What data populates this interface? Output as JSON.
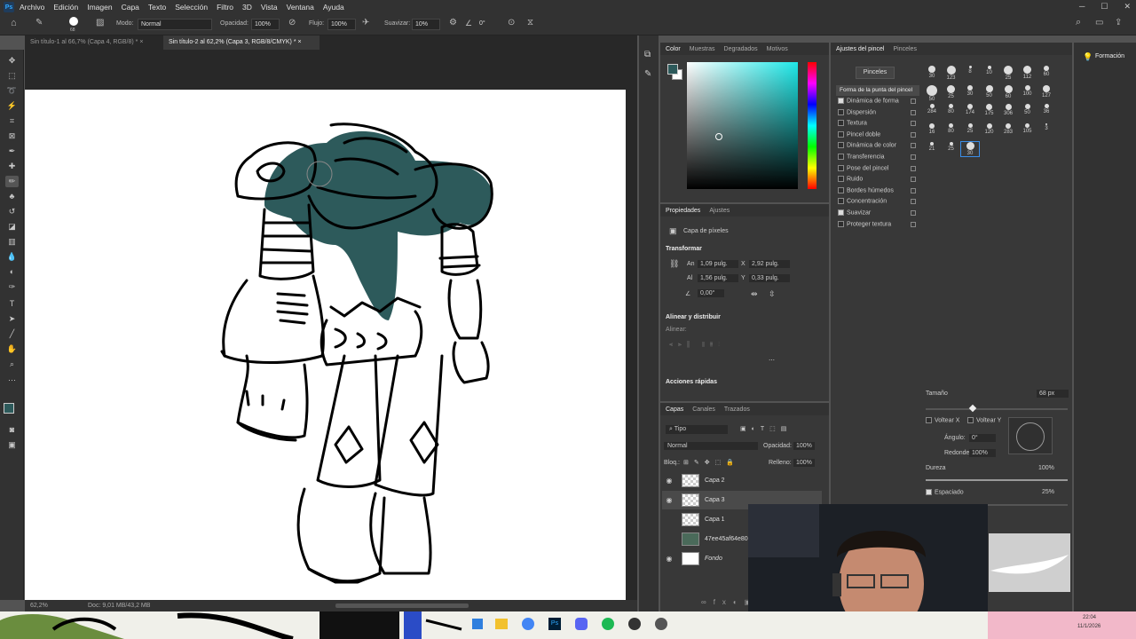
{
  "menu": {
    "items": [
      "Archivo",
      "Edición",
      "Imagen",
      "Capa",
      "Texto",
      "Selección",
      "Filtro",
      "3D",
      "Vista",
      "Ventana",
      "Ayuda"
    ]
  },
  "options_bar": {
    "brush_size": "68",
    "modo_label": "Modo:",
    "modo_value": "Normal",
    "opacidad_label": "Opacidad:",
    "opacidad_value": "100%",
    "flujo_label": "Flujo:",
    "flujo_value": "100%",
    "suavizar_label": "Suavizar:",
    "suavizar_value": "10%",
    "angle_value": "0°"
  },
  "tabs": [
    {
      "label": "Sin título-1 al 66,7% (Capa 4, RGB/8) *"
    },
    {
      "label": "Sin título-2 al 62,2% (Capa 3, RGB/8/CMYK) *"
    }
  ],
  "status": {
    "zoom": "62,2%",
    "doc": "Doc: 9,01 MB/43,2 MB"
  },
  "color_panel": {
    "tabs": [
      "Color",
      "Muestras",
      "Degradados",
      "Motivos"
    ],
    "fg_color": "#2d5a5b"
  },
  "properties": {
    "tabs": [
      "Propiedades",
      "Ajustes"
    ],
    "layer_type": "Capa de píxeles",
    "transform_title": "Transformar",
    "w_label": "An",
    "w_value": "1,09 pulg.",
    "x_label": "X",
    "x_value": "2,92 pulg.",
    "h_label": "Al",
    "h_value": "1,56 pulg.",
    "y_label": "Y",
    "y_value": "0,33 pulg.",
    "angle_value": "0,00°",
    "align_title": "Alinear y distribuir",
    "align_label": "Alinear:",
    "quick_title": "Acciones rápidas"
  },
  "layers_panel": {
    "tabs": [
      "Capas",
      "Canales",
      "Trazados"
    ],
    "filter": "Tipo",
    "blend": "Normal",
    "opacity_label": "Opacidad:",
    "opacity_value": "100%",
    "lock_label": "Bloq.:",
    "fill_label": "Relleno:",
    "fill_value": "100%",
    "layers": [
      {
        "name": "Capa 2"
      },
      {
        "name": "Capa 3"
      },
      {
        "name": "Capa 1"
      },
      {
        "name": "47ee45af64e80e5..."
      },
      {
        "name": "Fondo"
      }
    ]
  },
  "brush_settings": {
    "tabs": [
      "Ajustes del pincel",
      "Pinceles"
    ],
    "pinceles_button": "Pinceles",
    "section_header": "Forma de la punta del pincel",
    "options": [
      {
        "label": "Dinámica de forma",
        "checked": true
      },
      {
        "label": "Dispersión",
        "checked": false
      },
      {
        "label": "Textura",
        "checked": false
      },
      {
        "label": "Pincel doble",
        "checked": false
      },
      {
        "label": "Dinámica de color",
        "checked": false
      },
      {
        "label": "Transferencia",
        "checked": false
      },
      {
        "label": "Pose del pincel",
        "checked": false
      },
      {
        "label": "Ruido",
        "checked": false
      },
      {
        "label": "Bordes húmedos",
        "checked": false
      },
      {
        "label": "Concentración",
        "checked": false
      },
      {
        "label": "Suavizar",
        "checked": true
      },
      {
        "label": "Proteger textura",
        "checked": false
      }
    ],
    "presets": [
      "30",
      "123",
      "8",
      "10",
      "25",
      "112",
      "60",
      "50",
      "25",
      "30",
      "50",
      "60",
      "100",
      "127",
      "284",
      "80",
      "174",
      "175",
      "306",
      "50",
      "36",
      "16",
      "80",
      "25",
      "120",
      "283",
      "105",
      "3",
      "21",
      "25",
      "30"
    ],
    "size_label": "Tamaño",
    "size_value": "68 px",
    "flip_x": "Voltear X",
    "flip_y": "Voltear Y",
    "angle_label": "Ángulo:",
    "angle_value": "0°",
    "round_label": "Redondez:",
    "round_value": "100%",
    "hardness_label": "Dureza",
    "hardness_value": "100%",
    "spacing_label": "Espaciado",
    "spacing_value": "25%"
  },
  "formacion": {
    "label": "Formación"
  },
  "taskbar": {
    "time": "22:04",
    "date": "11/1/2026"
  }
}
